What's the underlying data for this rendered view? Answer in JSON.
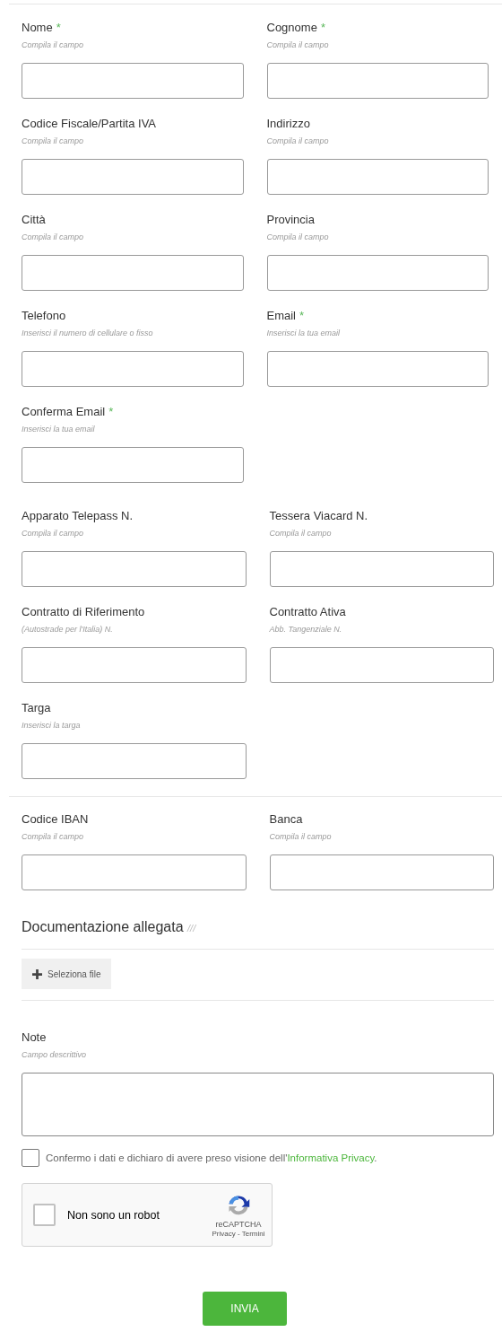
{
  "sections": [
    {
      "rows": [
        [
          {
            "label": "Nome",
            "required_mark": "*",
            "hint": "Compila il campo"
          },
          {
            "label": "Cognome",
            "required_mark": "*",
            "hint": "Compila il campo"
          }
        ],
        [
          {
            "label": "Codice Fiscale/Partita IVA",
            "hint": "Compila il campo"
          },
          {
            "label": "Indirizzo",
            "hint": "Compila il campo"
          }
        ],
        [
          {
            "label": "Città",
            "hint": "Compila il campo"
          },
          {
            "label": "Provincia",
            "hint": "Compila il campo"
          }
        ],
        [
          {
            "label": "Telefono",
            "hint": "Inserisci il numero di cellulare o fisso"
          },
          {
            "label": "Email",
            "required_mark": "*",
            "hint": "Inserisci la tua email"
          }
        ],
        [
          {
            "label": "Conferma Email",
            "required_mark": "*",
            "hint": "Inserisci la tua email"
          }
        ]
      ]
    },
    {
      "rows": [
        [
          {
            "label": "Apparato Telepass N.",
            "hint": "Compila il campo"
          },
          {
            "label": "Tessera Viacard N.",
            "hint": "Compila il campo"
          }
        ],
        [
          {
            "label": "Contratto di Riferimento",
            "hint": "(Autostrade per l'Italia) N."
          },
          {
            "label": "Contratto Ativa",
            "hint": "Abb. Tangenziale N."
          }
        ],
        [
          {
            "label": "Targa",
            "hint": "Inserisci la targa"
          }
        ]
      ]
    },
    {
      "rows": [
        [
          {
            "label": "Codice IBAN",
            "hint": "Compila il campo"
          },
          {
            "label": "Banca",
            "hint": "Compila il campo"
          }
        ]
      ]
    }
  ],
  "attachments": {
    "title": "Documentazione allegata",
    "title_mark": "///",
    "button": "Seleziona file"
  },
  "notes": {
    "label": "Note",
    "hint": "Campo descrittivo"
  },
  "consent": {
    "checked": false,
    "text": "Confermo i dati e dichiaro di avere preso visione dell'",
    "link": "Informativa Privacy",
    "after": "."
  },
  "captcha": {
    "checked": false,
    "label": "Non sono un robot",
    "brand": "reCAPTCHA",
    "links": "Privacy - Termini"
  },
  "submit": "INVIA"
}
